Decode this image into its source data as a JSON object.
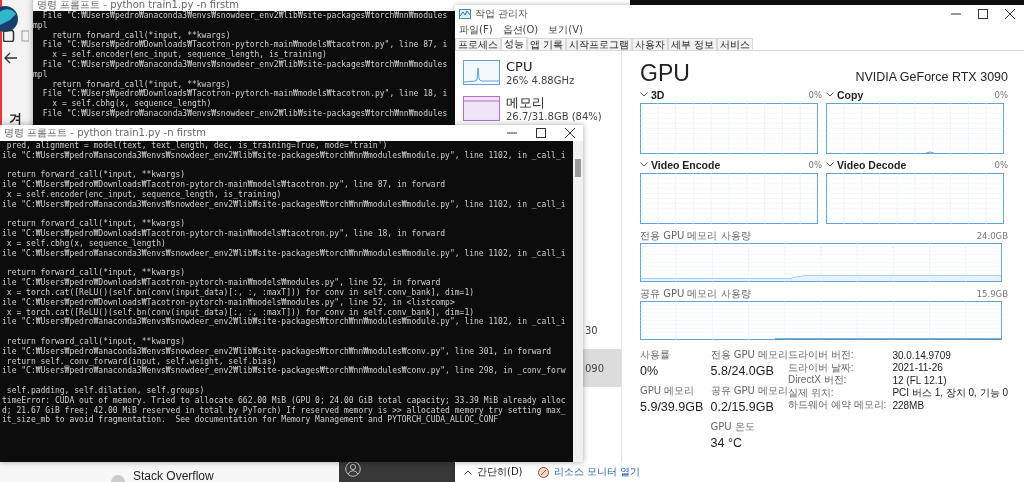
{
  "desktop": {
    "heading_fragment": "겨",
    "bookmark": "Stack Overflow"
  },
  "back_terminal": {
    "title": "명령 프롬프트 - python  train1.py -n firstm",
    "blocks": [
      [
        "  File \"C:₩Users₩pedro₩anaconda3₩envs₩snowdeer_env2₩lib₩site-packages₩torch₩nn₩modules",
        "mpl",
        "    return forward_call(*input, **kwargs)",
        "  File \"C:₩Users₩pedro₩Downloads₩Tacotron-pytorch-main₩models₩tacotron.py\", line 87, i",
        "    x = self.encoder(enc_input, sequence_length, is_training)",
        "  File \"C:₩Users₩pedro₩anaconda3₩envs₩snowdeer_env2₩lib₩site-packages₩torch₩nn₩modules",
        "mpl",
        "    return forward_call(*input, **kwargs)",
        "  File \"C:₩Users₩pedro₩Downloads₩Tacotron-pytorch-main₩models₩tacotron.py\", line 18, i",
        "    x = self.cbhg(x, sequence_length)",
        "  File \"C:₩Users₩pedro₩anaconda3₩envs₩snowdeer_env2₩lib₩site-packages₩torch₩nn₩modules"
      ]
    ]
  },
  "task_manager": {
    "title": "작업 관리자",
    "menu": [
      "파일(F)",
      "옵션(O)",
      "보기(V)"
    ],
    "tabs": [
      {
        "label": "프로세스",
        "selected": false
      },
      {
        "label": "성능",
        "selected": true
      },
      {
        "label": "앱 기록",
        "selected": false
      },
      {
        "label": "시작프로그램",
        "selected": false
      },
      {
        "label": "사용자",
        "selected": false
      },
      {
        "label": "세부 정보",
        "selected": false
      },
      {
        "label": "서비스",
        "selected": false
      }
    ],
    "sidebar": [
      {
        "kind": "cpu",
        "name": "CPU",
        "detail": "26% 4.88GHz",
        "selected": false
      },
      {
        "kind": "memory",
        "name": "메모리",
        "detail": "26.7/31.8GB (84%)",
        "selected": false
      },
      {
        "kind": "cut",
        "detail": "30",
        "selected": false
      },
      {
        "kind": "cut",
        "detail": "090",
        "selected": true
      }
    ],
    "gpu": {
      "title": "GPU",
      "model": "NVIDIA GeForce RTX 3090",
      "engines": [
        {
          "name": "3D",
          "value": "0%"
        },
        {
          "name": "Copy",
          "value": "0%"
        },
        {
          "name": "Video Encode",
          "value": "0%"
        },
        {
          "name": "Video Decode",
          "value": "0%"
        }
      ],
      "dedicated": {
        "label": "전용 GPU 메모리 사용량",
        "max": "24.0GB"
      },
      "shared": {
        "label": "공유 GPU 메모리 사용량",
        "max": "15.9GB"
      },
      "stat_columns": [
        [
          {
            "label": "사용률",
            "value": "0%"
          },
          {
            "label": "GPU 메모리",
            "value": "5.9/39.9GB"
          }
        ],
        [
          {
            "label": "전용 GPU 메모리",
            "value": "5.8/24.0GB"
          },
          {
            "label": "공유 GPU 메모리",
            "value": "0.2/15.9GB"
          },
          {
            "label": "GPU 온도",
            "value": "34 °C"
          }
        ]
      ],
      "properties": [
        {
          "key": "드라이버 버전:",
          "value": "30.0.14.9709"
        },
        {
          "key": "드라이버 날짜:",
          "value": "2021-11-26"
        },
        {
          "key": "DirectX 버전:",
          "value": "12 (FL 12.1)"
        },
        {
          "key": "실제 위치:",
          "value": "PCI 버스 1, 장치 0, 기능 0"
        },
        {
          "key": "하드웨어 예약 메모리:",
          "value": "228MB"
        }
      ]
    },
    "footer": {
      "collapse": "간단히(D)",
      "link": "리소스 모니터 열기"
    }
  },
  "front_terminal": {
    "title": "명령 프롬프트 - python  train1.py -n firstm",
    "blocks": [
      [
        " pred, alignment = model(text, text_length, dec, is_training=True, mode='train')",
        "ile \"C:₩Users₩pedro₩anaconda3₩envs₩snowdeer_env2₩lib₩site-packages₩torch₩nn₩modules₩module.py\", line 1102, in _call_i"
      ],
      [
        " return forward_call(*input, **kwargs)",
        "ile \"C:₩Users₩pedro₩Downloads₩Tacotron-pytorch-main₩models₩tacotron.py\", line 87, in forward",
        " x = self.encoder(enc_input, sequence_length, is_training)",
        "ile \"C:₩Users₩pedro₩anaconda3₩envs₩snowdeer_env2₩lib₩site-packages₩torch₩nn₩modules₩module.py\", line 1102, in _call_i"
      ],
      [
        " return forward_call(*input, **kwargs)",
        "ile \"C:₩Users₩pedro₩Downloads₩Tacotron-pytorch-main₩models₩tacotron.py\", line 18, in forward",
        " x = self.cbhg(x, sequence_length)",
        "ile \"C:₩Users₩pedro₩anaconda3₩envs₩snowdeer_env2₩lib₩site-packages₩torch₩nn₩modules₩module.py\", line 1102, in _call_i"
      ],
      [
        " return forward_call(*input, **kwargs)",
        "ile \"C:₩Users₩pedro₩Downloads₩Tacotron-pytorch-main₩models₩modules.py\", line 52, in forward",
        " x = torch.cat([ReLU()(self.bn(conv(input_data)[:, :, :maxT])) for conv in self.conv_bank], dim=1)",
        "ile \"C:₩Users₩pedro₩Downloads₩Tacotron-pytorch-main₩models₩modules.py\", line 52, in <listcomp>",
        " x = torch.cat([ReLU()(self.bn(conv(input_data)[:, :, :maxT])) for conv in self.conv_bank], dim=1)",
        "ile \"C:₩Users₩pedro₩anaconda3₩envs₩snowdeer_env2₩lib₩site-packages₩torch₩nn₩modules₩module.py\", line 1102, in _call_i"
      ],
      [
        " return forward_call(*input, **kwargs)",
        "ile \"C:₩Users₩pedro₩anaconda3₩envs₩snowdeer_env2₩lib₩site-packages₩torch₩nn₩modules₩conv.py\", line 301, in forward",
        " return self._conv_forward(input, self.weight, self.bias)",
        "ile \"C:₩Users₩pedro₩anaconda3₩envs₩snowdeer_env2₩lib₩site-packages₩torch₩nn₩modules₩conv.py\", line 298, in _conv_forw"
      ],
      [
        " self.padding, self.dilation, self.groups)",
        "timeError: CUDA out of memory. Tried to allocate 662.00 MiB (GPU 0; 24.00 GiB total capacity; 33.39 MiB already alloc",
        "d; 21.67 GiB free; 42.00 MiB reserved in total by PyTorch) If reserved memory is >> allocated memory try setting max_",
        "it_size_mb to avoid fragmentation.  See documentation for Memory Management and PYTORCH_CUDA_ALLOC_CONF"
      ]
    ]
  }
}
